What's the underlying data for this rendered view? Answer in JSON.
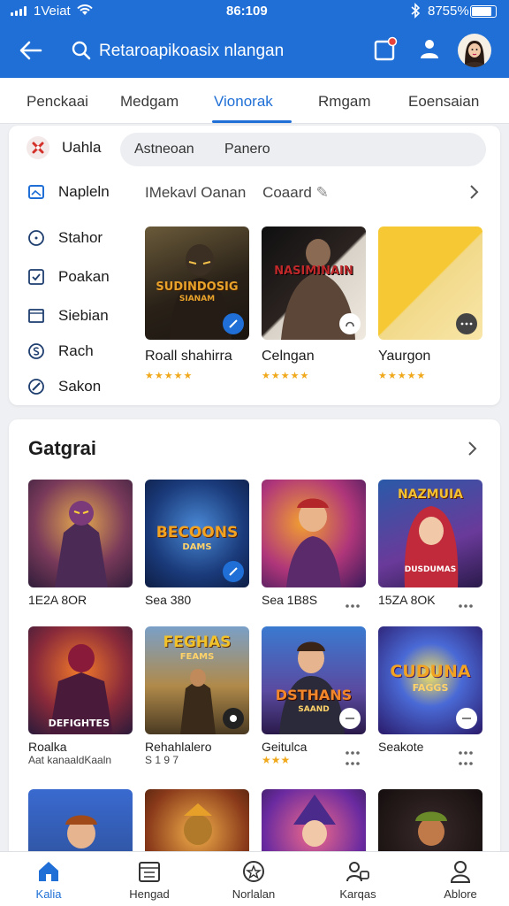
{
  "status_bar": {
    "carrier": "1Veiat",
    "time": "86:109",
    "battery": "8755%"
  },
  "header": {
    "search_text": "Retaroapikoasix nlangan"
  },
  "tabs": [
    {
      "label": "Penckaai",
      "active": false
    },
    {
      "label": "Medgam",
      "active": false
    },
    {
      "label": "Vionorak",
      "active": true
    },
    {
      "label": "Rmgam",
      "active": false
    },
    {
      "label": "Eoensaian",
      "active": false
    }
  ],
  "categories": [
    {
      "label": "Uahla",
      "icon": "game-icon"
    },
    {
      "label": "Napleln",
      "icon": "image-icon"
    },
    {
      "label": "Stahor",
      "icon": "clock-icon"
    },
    {
      "label": "Poakan",
      "icon": "check-icon"
    },
    {
      "label": "Siebian",
      "icon": "window-icon"
    },
    {
      "label": "Rach",
      "icon": "dollar-icon"
    },
    {
      "label": "Sakon",
      "icon": "compass-icon"
    }
  ],
  "filter_pill": {
    "left": "Astneoan",
    "right": "Panero"
  },
  "filter_row": {
    "left": "IMekavl Oanan",
    "right": "Coaard"
  },
  "featured": [
    {
      "title": "Roall shahirra",
      "art_text": "SUDINDOSIG",
      "art_sub": "SIANAM",
      "stars": "★★★★★"
    },
    {
      "title": "Celngan",
      "art_text": "NASIMINAIN",
      "art_sub": "",
      "stars": "★★★★★"
    },
    {
      "title": "Yaurgon",
      "art_text": "",
      "art_sub": "",
      "stars": "★★★★★"
    }
  ],
  "games_section": {
    "title": "Gatgrai"
  },
  "games": [
    {
      "line1": "1E2A 8OR",
      "line2": "",
      "art_text": "",
      "art_sub": ""
    },
    {
      "line1": "Sea 380",
      "line2": "",
      "art_text": "BECOONS",
      "art_sub": "DAMS"
    },
    {
      "line1": "Sea 1B8S",
      "line2": "",
      "art_text": "",
      "art_sub": ""
    },
    {
      "line1": "15ZA 8OK",
      "line2": "",
      "art_text": "NAZMUIA",
      "art_sub": "DUSDUMAS"
    },
    {
      "line1": "Roalka",
      "line2": "Aat kanaaldKaaln",
      "art_text": "DEFIGHTES",
      "art_sub": ""
    },
    {
      "line1": "Rehahlalero",
      "line2": "S 1 9 7",
      "art_text": "FEGHAS",
      "art_sub": "FEAMS"
    },
    {
      "line1": "Geitulca",
      "line2": "★★★",
      "art_text": "DSTHANS",
      "art_sub": "SAAND"
    },
    {
      "line1": "Seakote",
      "line2": "",
      "art_text": "CUDUNA",
      "art_sub": "FAGGS"
    },
    {
      "line1": "",
      "line2": "",
      "art_text": "",
      "art_sub": ""
    },
    {
      "line1": "",
      "line2": "",
      "art_text": "",
      "art_sub": ""
    },
    {
      "line1": "",
      "line2": "",
      "art_text": "",
      "art_sub": ""
    },
    {
      "line1": "",
      "line2": "",
      "art_text": "",
      "art_sub": ""
    }
  ],
  "bottom_nav": [
    {
      "label": "Kalia",
      "icon": "home-icon",
      "active": true
    },
    {
      "label": "Hengad",
      "icon": "calendar-icon",
      "active": false
    },
    {
      "label": "Norlalan",
      "icon": "star-icon",
      "active": false
    },
    {
      "label": "Karqas",
      "icon": "people-icon",
      "active": false
    },
    {
      "label": "Ablore",
      "icon": "profile-icon",
      "active": false
    }
  ],
  "colors": {
    "primary": "#1f6fd6",
    "star": "#f0a91c",
    "background": "#eef0f3"
  }
}
